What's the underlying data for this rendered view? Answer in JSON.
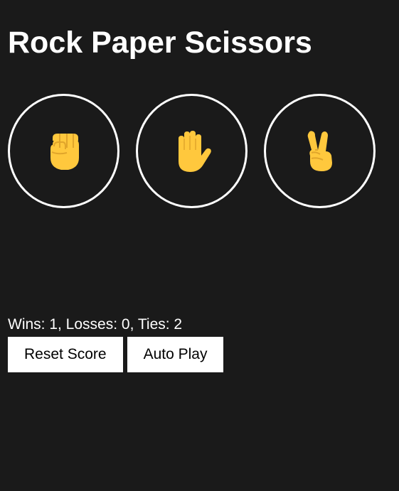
{
  "app": {
    "title": "Rock Paper Scissors"
  },
  "moves": [
    {
      "name": "rock",
      "icon": "raised-fist-icon"
    },
    {
      "name": "paper",
      "icon": "raised-hand-icon"
    },
    {
      "name": "scissors",
      "icon": "victory-hand-icon"
    }
  ],
  "status": {
    "result": "",
    "moves": "",
    "score": "Wins: 1, Losses: 0, Ties: 2"
  },
  "controls": {
    "reset_label": "Reset Score",
    "auto_play_label": "Auto Play"
  },
  "colors": {
    "background": "#1a1a1a",
    "emoji_yellow": "#ffc83d",
    "emoji_shade": "#e0a52b",
    "button_background": "#ffffff"
  }
}
